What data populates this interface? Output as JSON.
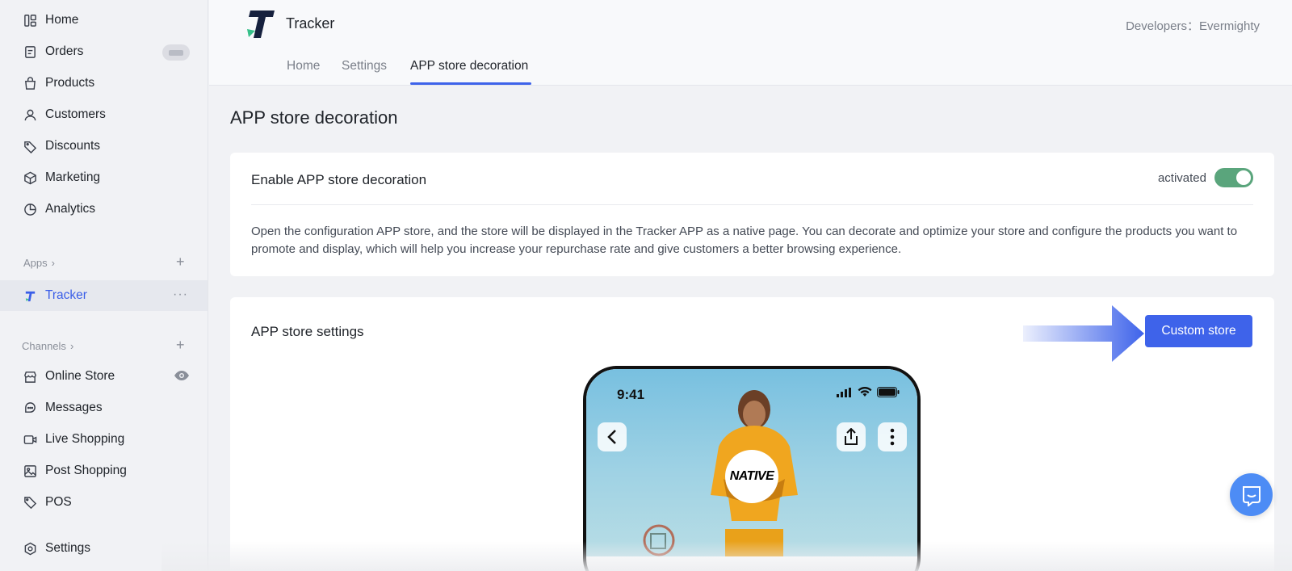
{
  "sidebar": {
    "items": [
      {
        "label": "Home",
        "icon": "dashboard-icon"
      },
      {
        "label": "Orders",
        "icon": "orders-icon"
      },
      {
        "label": "Products",
        "icon": "bag-icon"
      },
      {
        "label": "Customers",
        "icon": "person-icon"
      },
      {
        "label": "Discounts",
        "icon": "tag-icon"
      },
      {
        "label": "Marketing",
        "icon": "cube-icon"
      },
      {
        "label": "Analytics",
        "icon": "pie-chart-icon"
      }
    ],
    "apps_label": "Apps",
    "app_item": "Tracker",
    "channels_label": "Channels",
    "channels": [
      {
        "label": "Online Store",
        "icon": "store-icon"
      },
      {
        "label": "Messages",
        "icon": "chat-icon"
      },
      {
        "label": "Live Shopping",
        "icon": "video-icon"
      },
      {
        "label": "Post Shopping",
        "icon": "image-icon"
      },
      {
        "label": "POS",
        "icon": "tags-icon"
      }
    ],
    "settings_label": "Settings"
  },
  "header": {
    "app_title": "Tracker",
    "developers": "Developers：Evermighty",
    "tabs": [
      "Home",
      "Settings",
      "APP store decoration"
    ],
    "active_tab": "APP store decoration"
  },
  "main": {
    "page_title": "APP store decoration",
    "enable_card": {
      "title": "Enable APP store decoration",
      "toggle_label": "activated",
      "toggle_on": true,
      "description": "Open the configuration APP store, and the store will be displayed in the Tracker APP as a native page. You can decorate and optimize your store and configure the products you want to promote and display, which will help you increase your repurchase rate and give customers a better browsing experience."
    },
    "settings_card": {
      "title": "APP store settings",
      "button_label": "Custom store"
    },
    "phone": {
      "time": "9:41",
      "brand_logo": "NATIVE"
    }
  },
  "colors": {
    "accent": "#3e63ea",
    "toggle_on": "#5aa57c",
    "chat_button": "#4d8cf5"
  }
}
